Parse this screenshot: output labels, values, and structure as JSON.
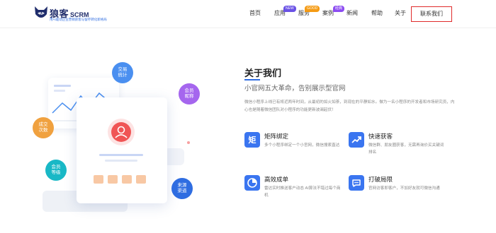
{
  "brand": {
    "name": "狼客",
    "suffix": "SCRM",
    "tagline": "用AI驱动企业营销获客与留存转化新格局"
  },
  "nav": {
    "items": [
      {
        "label": "首页"
      },
      {
        "label": "应用",
        "badge": "NEW"
      },
      {
        "label": "服务",
        "badge": "GOOD"
      },
      {
        "label": "案例",
        "badge": "经典"
      },
      {
        "label": "新闻"
      },
      {
        "label": "帮助"
      },
      {
        "label": "关于"
      }
    ],
    "contact": "联系我们"
  },
  "illustration": {
    "bubbles": {
      "trade": "交易统计",
      "member_nick": "会员昵称",
      "deal": "成交次数",
      "member_level": "会员等级",
      "source": "来源渠道"
    }
  },
  "about": {
    "title": "关于我们",
    "subtitle": "小官网五大革命，告别展示型官网",
    "description": "微信小程序上线已有将近两年时间，从最初的如火如荼，到现在的平静如水。做为一名小程序的开发者和市场研究员，内心也是随着微信团队对小程序的功能更新波澜起伏！"
  },
  "features": [
    {
      "title": "矩阵绑定",
      "desc": "多个小程序绑定一个小官网，微信搜索直达",
      "icon": "matrix-icon"
    },
    {
      "title": "快速获客",
      "desc": "微信群、朋友圈获客，无需再询价买关键词排名",
      "icon": "growth-icon"
    },
    {
      "title": "高效成单",
      "desc": "雷达实时推送客户动态 AI算法不错过每个商机",
      "icon": "pie-chart-icon"
    },
    {
      "title": "打破局限",
      "desc": "官网访客即客户，不加好友就可微信沟通",
      "icon": "chat-icon"
    }
  ],
  "colors": {
    "accent": "#3a75f0",
    "contact_border": "#e02b2b",
    "bubble_blue": "#4a8ff0",
    "bubble_purple": "#a566ee",
    "bubble_orange": "#f0a13f",
    "bubble_teal": "#19b8c6",
    "avatar": "#f05555"
  }
}
